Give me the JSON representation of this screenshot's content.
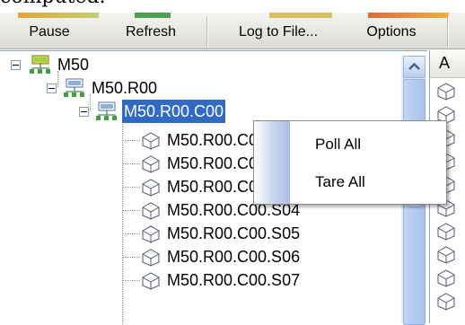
{
  "page_top_text": "computed.",
  "toolbar": {
    "buttons": [
      {
        "label": "Pause"
      },
      {
        "label": "Refresh"
      },
      {
        "label": "Log to File..."
      },
      {
        "label": "Options"
      }
    ]
  },
  "tree": {
    "nodes": [
      {
        "label": "M50",
        "level": 0,
        "type": "network"
      },
      {
        "label": "M50.R00",
        "level": 1,
        "type": "network"
      },
      {
        "label": "M50.R00.C00",
        "level": 2,
        "type": "network",
        "selected": true
      },
      {
        "label": "M50.R00.C00.S01",
        "level": 3,
        "type": "sensor"
      },
      {
        "label": "M50.R00.C00.S02",
        "level": 3,
        "type": "sensor"
      },
      {
        "label": "M50.R00.C00.S03",
        "level": 3,
        "type": "sensor"
      },
      {
        "label": "M50.R00.C00.S04",
        "level": 3,
        "type": "sensor"
      },
      {
        "label": "M50.R00.C00.S05",
        "level": 3,
        "type": "sensor"
      },
      {
        "label": "M50.R00.C00.S06",
        "level": 3,
        "type": "sensor"
      },
      {
        "label": "M50.R00.C00.S07",
        "level": 3,
        "type": "sensor"
      }
    ]
  },
  "right_pane": {
    "header": "A"
  },
  "context_menu": {
    "items": [
      {
        "label": "Poll All"
      },
      {
        "label": "Tare All"
      }
    ]
  },
  "colors": {
    "selection": "#316ac5",
    "scrollbar": "#b9ceef",
    "menu_gutter": "#a9bde6"
  }
}
